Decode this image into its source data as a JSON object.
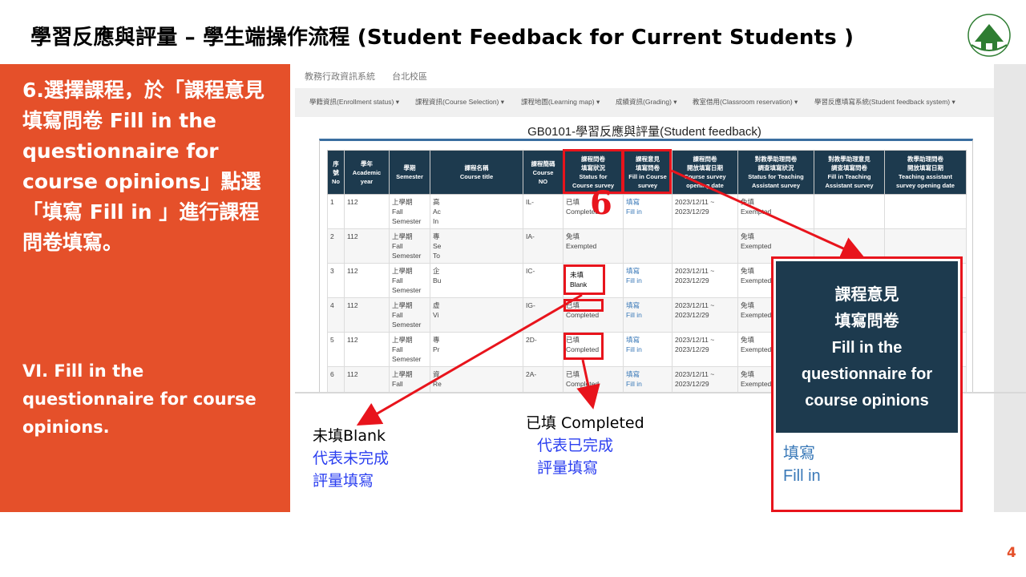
{
  "slide": {
    "title": "學習反應與評量 – 學生端操作流程 (Student Feedback for Current Students )",
    "page_number": "4",
    "logo": {
      "name": "shih-chien-university-logo",
      "text": "SHIH CHIEN UNIVERSITY",
      "seal": "實踐"
    }
  },
  "left_panel": {
    "step_zh": "6.選擇課程，於「課程意見填寫問卷 Fill in the questionnaire for course opinions」點選「填寫 Fill in 」進行課程問卷填寫。",
    "step_en": "VI. Fill in the questionnaire  for course opinions."
  },
  "app": {
    "system_name": "教務行政資訊系統",
    "campus": "台北校區",
    "nav": [
      "學籍資訊(Enrollment status) ▾",
      "課程資訊(Course Selection) ▾",
      "課程地圖(Learning map) ▾",
      "成績資訊(Grading) ▾",
      "教室借用(Classroom reservation) ▾",
      "學習反應填寫系統(Student feedback system) ▾"
    ],
    "page_heading": "GB0101-學習反應與評量(Student feedback)",
    "table": {
      "headers": [
        "序\n號\nNo",
        "學年\nAcademic\nyear",
        "學期\nSemester",
        "課程名稱\nCourse title",
        "課程簡碼\nCourse\nNO",
        "課程問卷\n填寫狀況\nStatus for\nCourse survey",
        "課程意見\n填寫問卷\nFill in Course\nsurvey",
        "課程問卷\n開放填寫日期\nCourse survey\nopening date",
        "對教學助理問卷\n調查填寫狀況\nStatus for Teaching\nAssistant survey",
        "對教學助理意見\n調查填寫問卷\nFill in Teaching\nAssistant survey",
        "教學助理問卷\n開放填寫日期\nTeaching assistant\nsurvey opening date"
      ],
      "rows": [
        {
          "no": "1",
          "year": "112",
          "semester": "上學期\nFall\nSemester",
          "title": "高\nAc\nIn",
          "code": "IL-",
          "status": "已填\nCompleted",
          "fill": "填寫\nFill in",
          "dates": "2023/12/11 ~\n2023/12/29",
          "ta_status": "免填\nExempted",
          "ta_fill": "",
          "ta_dates": ""
        },
        {
          "no": "2",
          "year": "112",
          "semester": "上學期\nFall\nSemester",
          "title": "專\nSe\nTo",
          "code": "IA-",
          "status": "免填\nExempted",
          "fill": "",
          "dates": "",
          "ta_status": "免填\nExempted",
          "ta_fill": "",
          "ta_dates": ""
        },
        {
          "no": "3",
          "year": "112",
          "semester": "上學期\nFall\nSemester",
          "title": "企\nBu",
          "code": "IC-",
          "status": "未填\nBlank",
          "fill": "填寫\nFill in",
          "dates": "2023/12/11 ~\n2023/12/29",
          "ta_status": "免填\nExempted",
          "ta_fill": "",
          "ta_dates": ""
        },
        {
          "no": "4",
          "year": "112",
          "semester": "上學期\nFall\nSemester",
          "title": "虛\nVi",
          "code": "IG-",
          "status": "已填\nCompleted",
          "fill": "填寫\nFill in",
          "dates": "2023/12/11 ~\n2023/12/29",
          "ta_status": "免填\nExempted",
          "ta_fill": "",
          "ta_dates": ""
        },
        {
          "no": "5",
          "year": "112",
          "semester": "上學期\nFall\nSemester",
          "title": "專\nPr",
          "code": "2D-",
          "status": "已填\nCompleted",
          "fill": "填寫\nFill in",
          "dates": "2023/12/11 ~\n2023/12/29",
          "ta_status": "免填\nExempted",
          "ta_fill": "",
          "ta_dates": ""
        },
        {
          "no": "6",
          "year": "112",
          "semester": "上學期\nFall",
          "title": "資\nRe",
          "code": "2A-",
          "status": "已填\nCompleted",
          "fill": "填寫\nFill in",
          "dates": "2023/12/11 ~\n2023/12/29",
          "ta_status": "免填\nExempted",
          "ta_fill": "",
          "ta_dates": ""
        }
      ]
    }
  },
  "annotations": {
    "step_marker": "6",
    "zoom_header": "課程意見\n填寫問卷\nFill in the\nquestionnaire for\ncourse opinions",
    "zoom_link_zh": "填寫",
    "zoom_link_en": "Fill in",
    "blank_label": "未填Blank",
    "blank_desc_1": "代表未完成",
    "blank_desc_2": "評量填寫",
    "completed_label": "已填 Completed",
    "completed_desc_1": "代表已完成",
    "completed_desc_2": "評量填寫"
  },
  "colors": {
    "accent_orange": "#e5502a",
    "header_navy": "#1d3a4e",
    "annotation_red": "#e8141c",
    "link_blue": "#3a79b8",
    "caption_blue": "#2b3ff0"
  }
}
